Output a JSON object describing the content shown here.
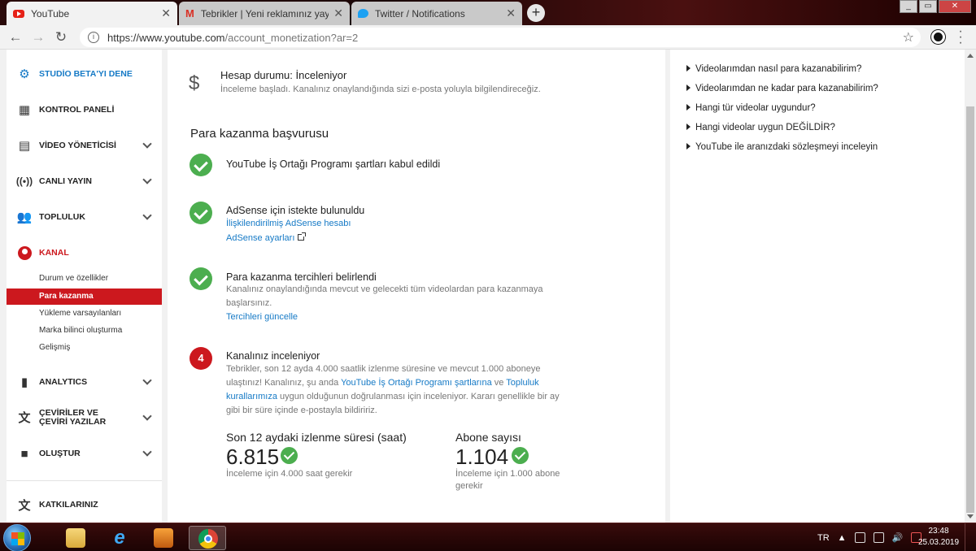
{
  "browser": {
    "tabs": [
      {
        "title": "YouTube",
        "icon": "youtube-icon"
      },
      {
        "title": "Tebrikler | Yeni reklamınız yayınla",
        "icon": "gmail-icon"
      },
      {
        "title": "Twitter / Notifications",
        "icon": "twitter-icon"
      }
    ],
    "url_host": "https://www.youtube.com",
    "url_path": "/account_monetization?ar=2",
    "colors": {
      "tabbar_bg": "#2a0a0a",
      "youtube_red": "#cc181e"
    }
  },
  "sidebar": {
    "items": [
      {
        "label": "STUDİO BETA'YI DENE",
        "icon": "gear-icon"
      },
      {
        "label": "KONTROL PANELİ",
        "icon": "dashboard-icon"
      },
      {
        "label": "VİDEO YÖNETİCİSİ",
        "icon": "video-manager-icon"
      },
      {
        "label": "CANLI YAYIN",
        "icon": "live-icon"
      },
      {
        "label": "TOPLULUK",
        "icon": "people-icon"
      },
      {
        "label": "KANAL",
        "icon": "account-icon"
      },
      {
        "label": "ANALYTICS",
        "icon": "bar-chart-icon"
      },
      {
        "label": "ÇEVİRİLER VE ÇEVİRİ YAZILAR",
        "icon": "translate-icon"
      },
      {
        "label": "OLUŞTUR",
        "icon": "camera-icon"
      },
      {
        "label": "KATKILARINIZ",
        "icon": "translate-icon"
      }
    ],
    "kanal_sub": [
      {
        "label": "Durum ve özellikler"
      },
      {
        "label": "Para kazanma"
      },
      {
        "label": "Yükleme varsayılanları"
      },
      {
        "label": "Marka bilinci oluşturma"
      },
      {
        "label": "Gelişmiş"
      }
    ]
  },
  "main": {
    "account_status_title": "Hesap durumu: İnceleniyor",
    "account_status_desc": "İnceleme başladı. Kanalınız onaylandığında sizi e-posta yoluyla bilgilendireceğiz.",
    "section_title": "Para kazanma başvurusu",
    "steps": [
      {
        "title": "YouTube İş Ortağı Programı şartları kabul edildi"
      },
      {
        "title": "AdSense için istekte bulunuldu",
        "link1": "İlişkilendirilmiş AdSense hesabı",
        "link2": "AdSense ayarları"
      },
      {
        "title": "Para kazanma tercihleri belirlendi",
        "text": "Kanalınız onaylandığında mevcut ve gelecekti tüm videolardan para kazanmaya başlarsınız.",
        "link": "Tercihleri güncelle"
      },
      {
        "number": "4",
        "title": "Kanalınız inceleniyor",
        "text_part1": "Tebrikler, son 12 ayda 4.000 saatlik izlenme süresine ve mevcut 1.000 aboneye ulaştınız! Kanalınız, şu anda ",
        "link_a": "YouTube İş Ortağı Programı şartlarına",
        "text_part2": " ve ",
        "link_b": "Topluluk kurallarımıza",
        "text_part3": " uygun olduğunun doğrulanması için inceleniyor. Kararı genellikle bir ay gibi bir süre içinde e-postayla bildiririz."
      }
    ],
    "metrics": [
      {
        "label": "Son 12 aydaki izlenme süresi (saat)",
        "value": "6.815",
        "note": "İnceleme için 4.000 saat gerekir"
      },
      {
        "label": "Abone sayısı",
        "value": "1.104",
        "note": "İnceleme için 1.000 abone gerekir"
      }
    ]
  },
  "side_panel": {
    "faqs": [
      "Videolarımdan nasıl para kazanabilirim?",
      "Videolarımdan ne kadar para kazanabilirim?",
      "Hangi tür videolar uygundur?",
      "Hangi videolar uygun DEĞİLDİR?",
      "YouTube ile aranızdaki sözleşmeyi inceleyin"
    ]
  },
  "taskbar": {
    "language": "TR",
    "time": "23:48",
    "date": "25.03.2019"
  }
}
